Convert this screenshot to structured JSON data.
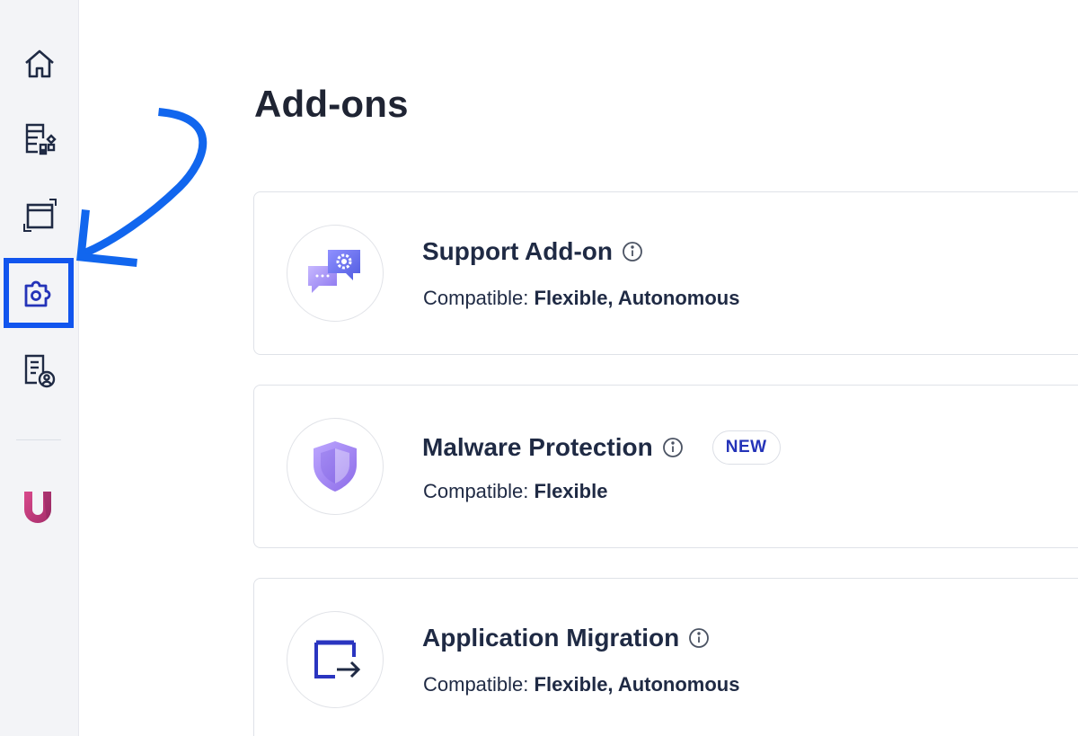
{
  "sidebar": {
    "items": [
      {
        "icon": "home-icon",
        "active": false
      },
      {
        "icon": "apps-grid-icon",
        "active": false
      },
      {
        "icon": "window-resize-icon",
        "active": false
      },
      {
        "icon": "addon-puzzle-icon",
        "active": true
      },
      {
        "icon": "user-report-icon",
        "active": false
      }
    ],
    "brand": "U",
    "accent_color": "#1155ee"
  },
  "page": {
    "title": "Add-ons"
  },
  "addons": [
    {
      "title": "Support Add-on",
      "compat_label": "Compatible:",
      "compat_value": "Flexible, Autonomous",
      "icon": "support-chat-icon",
      "badge": ""
    },
    {
      "title": "Malware Protection",
      "compat_label": "Compatible:",
      "compat_value": "Flexible",
      "icon": "shield-icon",
      "badge": "NEW"
    },
    {
      "title": "Application Migration",
      "compat_label": "Compatible:",
      "compat_value": "Flexible, Autonomous",
      "icon": "migration-icon",
      "badge": ""
    }
  ]
}
